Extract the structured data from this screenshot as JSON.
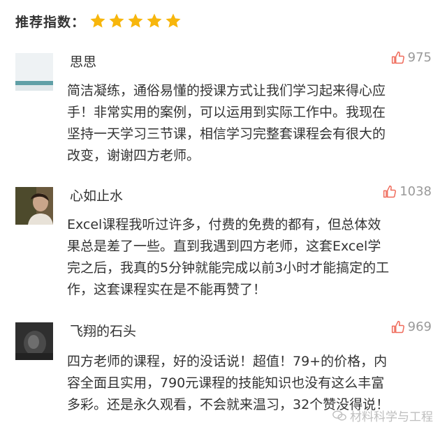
{
  "rating": {
    "label": "推荐指数：",
    "stars": 5,
    "star_color": "#f7b60c"
  },
  "comments": [
    {
      "user": "思思",
      "likes": "975",
      "avatar": "avatar-teal-landscape",
      "lines": [
        "简洁凝练，通俗易懂的授课方式让我们学习起来得心应",
        "手！非常实用的案例，可以运用到实际工作中。我现在",
        "坚持一天学习三节课，相信学习完整套课程会有很大的",
        "改变，谢谢四方老师。"
      ]
    },
    {
      "user": "心如止水",
      "likes": "1038",
      "avatar": "avatar-person-photo",
      "lines": [
        "Excel课程我听过许多，付费的免费的都有，但总体效",
        "果总是差了一些。直到我遇到四方老师，这套Excel学",
        "完之后，我真的5分钟就能完成以前3小时才能搞定的工",
        "作，这套课程实在是不能再赞了！"
      ]
    },
    {
      "user": "飞翔的石头",
      "likes": "969",
      "avatar": "avatar-dark-photo",
      "lines": [
        "四方老师的课程，好的没话说！超值！79+的价格，内",
        "容全面且实用，790元课程的技能知识也没有这么丰富",
        "多彩。还是永久观看，不会就来温习，32个赞没得说！"
      ]
    }
  ],
  "watermark": {
    "text": "材料科学与工程",
    "icon": "wechat-icon"
  },
  "colors": {
    "text": "#333333",
    "muted": "#999999",
    "star": "#f7b60c"
  }
}
